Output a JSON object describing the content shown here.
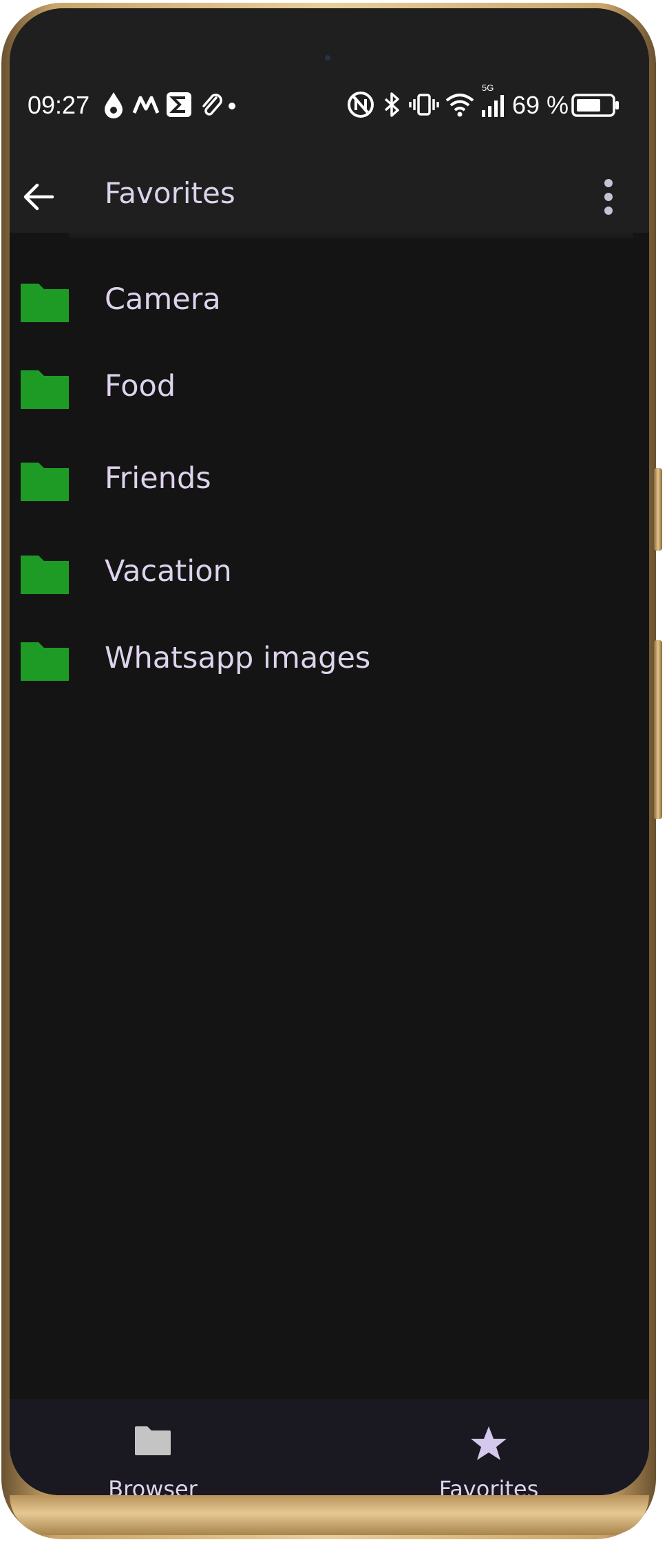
{
  "status_bar": {
    "time": "09:27",
    "network_type": "5G",
    "battery_percent": "69 %",
    "icons": [
      "drop-icon",
      "m-logo-icon",
      "sigma-icon",
      "paperclip-icon",
      "dot-icon",
      "nfc-icon",
      "bluetooth-icon",
      "vibrate-icon",
      "wifi-icon",
      "signal-icon",
      "battery-icon"
    ]
  },
  "app_bar": {
    "title": "Favorites",
    "back_icon": "arrow-left-icon",
    "menu_icon": "more-vertical-icon"
  },
  "favorites": [
    {
      "label": "Camera"
    },
    {
      "label": "Food"
    },
    {
      "label": "Friends"
    },
    {
      "label": "Vacation"
    },
    {
      "label": "Whatsapp images"
    }
  ],
  "bottom_nav": {
    "items": [
      {
        "label": "Browser",
        "icon": "folder-icon",
        "selected": false
      },
      {
        "label": "Favorites",
        "icon": "star-icon",
        "selected": true
      }
    ]
  },
  "colors": {
    "folder": "#1e9b25",
    "text": "#ddd3ec",
    "background": "#141414",
    "app_bar": "#1f1f1f",
    "nav_bar": "#1a1820"
  }
}
